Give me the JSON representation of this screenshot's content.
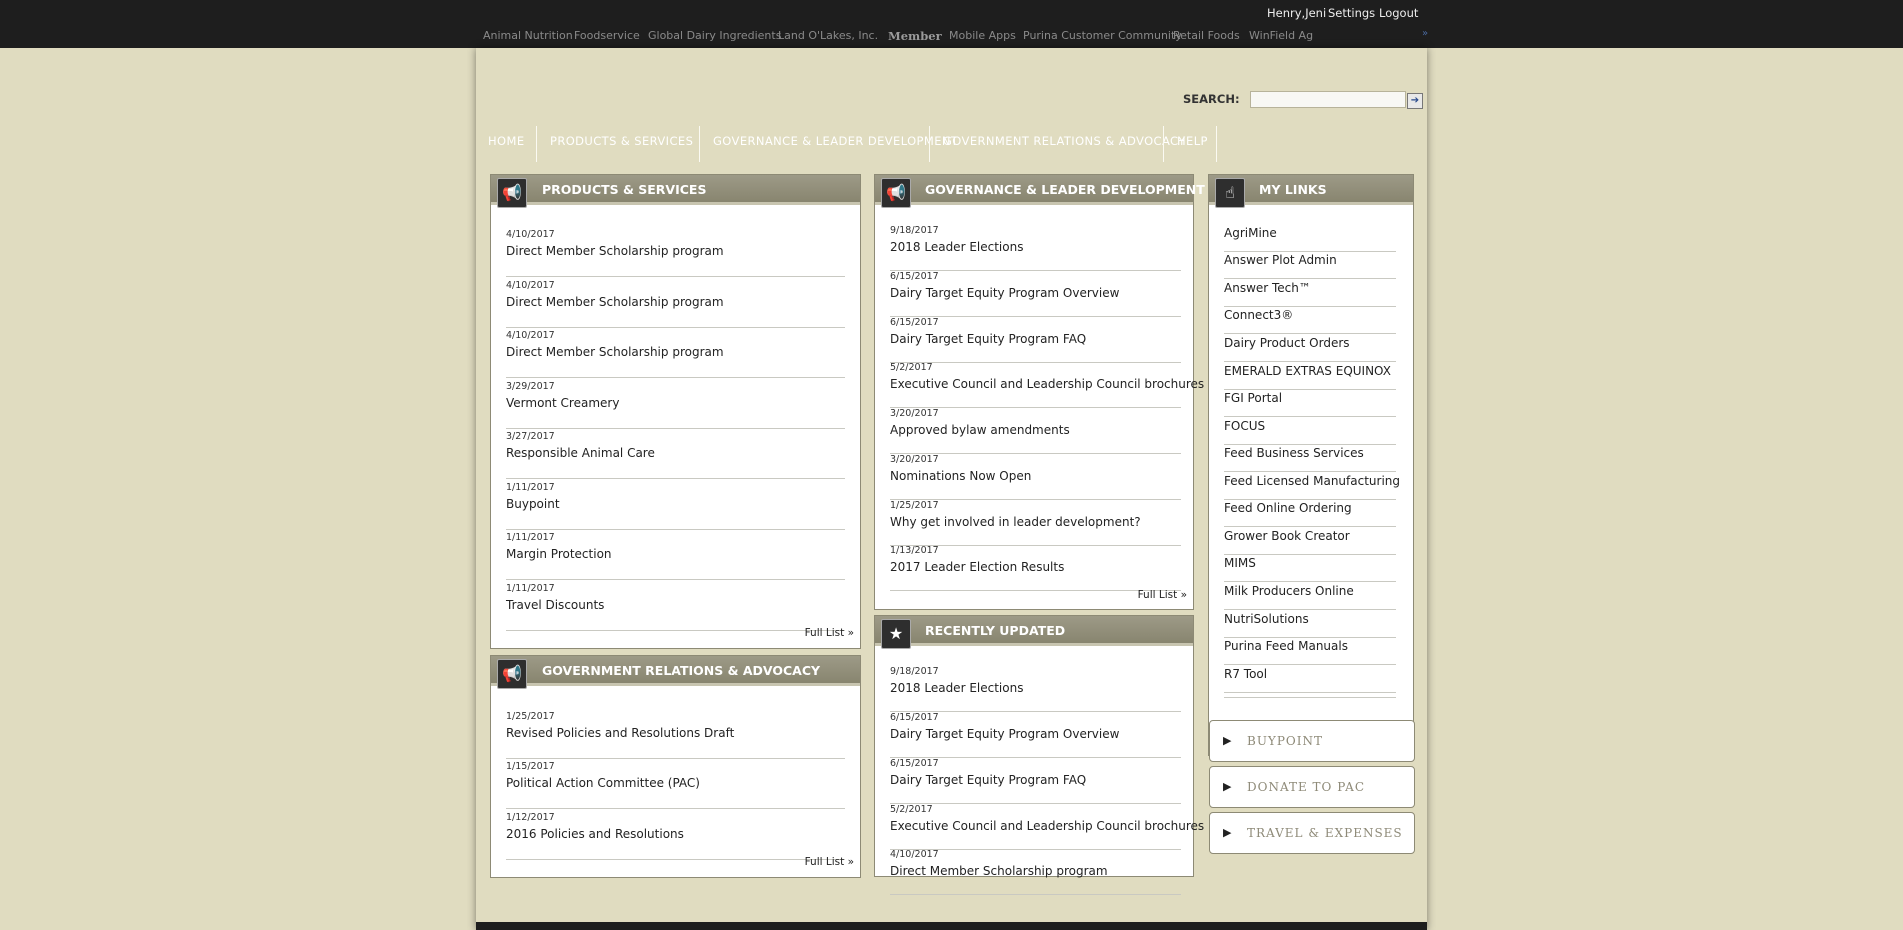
{
  "user": {
    "name": "Henry,Jeni",
    "settings": "Settings",
    "logout": "Logout"
  },
  "sites": [
    "Animal Nutrition",
    "Foodservice",
    "Global Dairy Ingredients",
    "Land O'Lakes, Inc.",
    "Member",
    "Mobile Apps",
    "Purina Customer Community",
    "Retail Foods",
    "WinField Ag"
  ],
  "search": {
    "label": "SEARCH:",
    "value": ""
  },
  "nav": [
    "HOME",
    "PRODUCTS & SERVICES",
    "GOVERNANCE & LEADER DEVELOPMENT",
    "GOVERNMENT RELATIONS & ADVOCACY",
    "HELP"
  ],
  "products": {
    "title": "PRODUCTS & SERVICES",
    "items": [
      {
        "date": "4/10/2017",
        "title": "Direct Member Scholarship program"
      },
      {
        "date": "4/10/2017",
        "title": "Direct Member Scholarship program"
      },
      {
        "date": "4/10/2017",
        "title": "Direct Member Scholarship program"
      },
      {
        "date": "3/29/2017",
        "title": "Vermont Creamery"
      },
      {
        "date": "3/27/2017",
        "title": "Responsible Animal Care"
      },
      {
        "date": "1/11/2017",
        "title": "Buypoint"
      },
      {
        "date": "1/11/2017",
        "title": "Margin Protection"
      },
      {
        "date": "1/11/2017",
        "title": "Travel Discounts"
      }
    ],
    "full_list": "Full List »"
  },
  "government": {
    "title": "GOVERNMENT RELATIONS & ADVOCACY",
    "items": [
      {
        "date": "1/25/2017",
        "title": "Revised Policies and Resolutions Draft"
      },
      {
        "date": "1/15/2017",
        "title": "Political Action Committee (PAC)"
      },
      {
        "date": "1/12/2017",
        "title": "2016 Policies and Resolutions"
      }
    ],
    "full_list": "Full List »"
  },
  "governance": {
    "title": "GOVERNANCE & LEADER DEVELOPMENT",
    "items": [
      {
        "date": "9/18/2017",
        "title": "2018 Leader Elections"
      },
      {
        "date": "6/15/2017",
        "title": "Dairy Target Equity Program Overview"
      },
      {
        "date": "6/15/2017",
        "title": "Dairy Target Equity Program FAQ"
      },
      {
        "date": "5/2/2017",
        "title": "Executive Council and Leadership Council brochures"
      },
      {
        "date": "3/20/2017",
        "title": "Approved bylaw amendments"
      },
      {
        "date": "3/20/2017",
        "title": "Nominations Now Open"
      },
      {
        "date": "1/25/2017",
        "title": "Why get involved in leader development?"
      },
      {
        "date": "1/13/2017",
        "title": "2017 Leader Election Results"
      }
    ],
    "full_list": "Full List »"
  },
  "recent": {
    "title": "RECENTLY UPDATED",
    "items": [
      {
        "date": "9/18/2017",
        "title": "2018 Leader Elections"
      },
      {
        "date": "6/15/2017",
        "title": "Dairy Target Equity Program Overview"
      },
      {
        "date": "6/15/2017",
        "title": "Dairy Target Equity Program FAQ"
      },
      {
        "date": "5/2/2017",
        "title": "Executive Council and Leadership Council brochures"
      },
      {
        "date": "4/10/2017",
        "title": "Direct Member Scholarship program"
      }
    ]
  },
  "mylinks": {
    "title": "MY LINKS",
    "items": [
      "AgriMine",
      "Answer Plot Admin",
      "Answer Tech™",
      "Connect3®",
      "Dairy Product Orders",
      "EMERALD EXTRAS EQUINOX",
      "FGI Portal",
      "FOCUS",
      "Feed Business Services",
      "Feed Licensed Manufacturing",
      "Feed Online Ordering",
      "Grower Book Creator",
      "MIMS",
      "Milk Producers Online",
      "NutriSolutions",
      "Purina Feed Manuals",
      "R7 Tool"
    ]
  },
  "side_buttons": [
    "BUYPOINT",
    "DONATE TO PAC",
    "TRAVEL & EXPENSES"
  ]
}
